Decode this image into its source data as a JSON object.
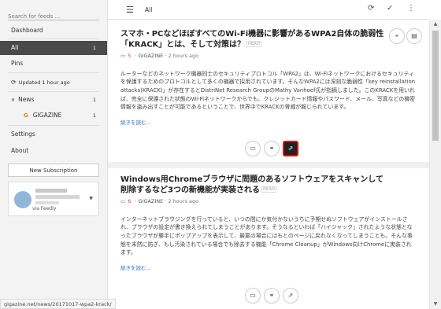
{
  "sidebar": {
    "search_placeholder": "Search for feeds ...",
    "dashboard": "Dashboard",
    "all": {
      "label": "All",
      "count": "1"
    },
    "pins": "Pins",
    "updated": "Updated 1 hour ago",
    "news": {
      "label": "News",
      "count": "1"
    },
    "gigazine": {
      "label": "GIGAZINE",
      "count": "1"
    },
    "settings": "Settings",
    "about": "About",
    "new_subscription": "New Subscription",
    "via": "via Feedly"
  },
  "toolbar": {
    "title": "All",
    "hamburger_icon": "menu-icon",
    "refresh_icon": "refresh-icon",
    "mark_read_icon": "check-icon",
    "more_icon": "more-vert-icon"
  },
  "articles": [
    {
      "title": "スマホ・PCなどほぼすべてのWi-Fi機器に影響があるWPA2自体の脆弱性「KRACK」とは、そして対策は？",
      "read_tag": "READ",
      "comments": "5",
      "source": "GIGAZINE",
      "time": "2 hours ago",
      "body": "ルーターなどのネットワーク機器同士のセキュリティプロトコル「WPA2」は、Wi-Fiネットワークにおけるセキュリティを保護するためのプロトコルとして多くの機器で採用されています。そんなWPA2には深刻な脆弱性「key reinstallation attacks(KRACK)」が存在するとDistriNet Research GroupのMathy Vanhoef氏が指摘しました。このKRACKを用いれば、完全に保護された状態のWi-Fiネットワークからでも、クレジットカード情報やパスワード、メール、写真などの機密情報を盗み出すことが可能であるということで、世界中でKRACKの脅威が報じられています。",
      "read_more": "続きを読む..."
    },
    {
      "title": "Windows用Chromeブラウザに問題のあるソフトウェアをスキャンして削除するなど3つの新機能が実装される",
      "read_tag": "READ",
      "comments": "6",
      "source": "GIGAZINE",
      "time": "2 hours ago",
      "body": "インターネットブラウジングを行っていると、いつの間にか気付かないうちに予期せぬソフトウェアがインストールされ、ブラウザの設定が書き換えられてしまうことがあります。そうなるといわば「ハイジャック」されたような状態となったブラウザが勝手にポップアップを表示して、最悪の場合にはもとのページに戻れなくなってしまうことも。そんな事態を未然に防ぎ、もし汚染されている場合でも除去する機能「Chrome Cleanup」がWindows向けChromeに実装されます。",
      "read_more": "続きを読む..."
    }
  ],
  "status_url": "gigazine.net/news/20171017-wpa2-krack/"
}
